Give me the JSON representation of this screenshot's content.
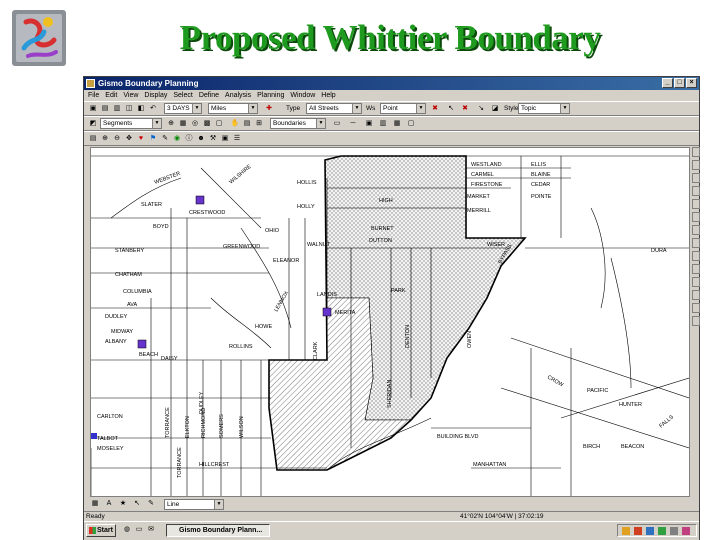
{
  "slide": {
    "title": "Proposed Whittier Boundary"
  },
  "window": {
    "title": "Gismo Boundary Planning",
    "menu": [
      "File",
      "Edit",
      "View",
      "Display",
      "Select",
      "Define",
      "Analysis",
      "Planning",
      "Window",
      "Help"
    ],
    "toolbar1": {
      "scale_value": "3 DAYS",
      "units_value": "Miles",
      "layer_label": "Type",
      "layer_value": "All Streets",
      "label_label": "Ws",
      "label_value": "Point",
      "style_label": "Style",
      "style_value": "Topic"
    },
    "toolbar2": {
      "segments_value": "Segments",
      "boundaries_value": "Boundaries"
    },
    "bottom": {
      "type_value": "Line"
    },
    "status": {
      "left": "Ready",
      "coords": "41°02'N 104°04'W | 37:02:19"
    },
    "taskbar": {
      "start": "Start",
      "task": "Gismo Boundary Plann..."
    },
    "accent_colors": {
      "titlebar": "#0a246a",
      "school_marker": "#6633cc",
      "slide_title": "#1e9a1e"
    }
  },
  "map": {
    "street_labels": [
      "WEBSTER",
      "WILSHIRE",
      "CRESTWOOD",
      "SLATER",
      "BOYD",
      "STANBERY",
      "CHATHAM",
      "COLUMBIA",
      "AVA",
      "MIDWAY",
      "DUDLEY",
      "ALBANY",
      "BEACH",
      "DAISY",
      "TORRANCE",
      "ELKTON",
      "RICHMOND",
      "SOMERS",
      "WILSON",
      "ROLLINS",
      "HOWE",
      "GREENWOOD",
      "ELEANOR",
      "LANDIS",
      "MERITA",
      "CLARK",
      "OHIO",
      "TORRANCE",
      "LENNOX",
      "DUDLEY",
      "HOLLIS",
      "HOLLY",
      "WALNUT",
      "BURNET",
      "DUTTON",
      "PARK",
      "HIGH",
      "WESTLAND",
      "CARMEL",
      "FIRESTONE",
      "ELLIS",
      "BLAINE",
      "CEDAR",
      "WISER",
      "MERRILL",
      "POINTE",
      "MARKET",
      "HILLCREST",
      "BUILDING BLVD",
      "MANHATTAN",
      "TALBOT",
      "MOSELEY",
      "CARLTON",
      "DENTON",
      "OWEN",
      "SHERIDAN",
      "DURA",
      "PACIFIC",
      "HUNTER",
      "FALLS",
      "BEACON",
      "CROW",
      "BIRCH",
      "BYPASS"
    ]
  }
}
